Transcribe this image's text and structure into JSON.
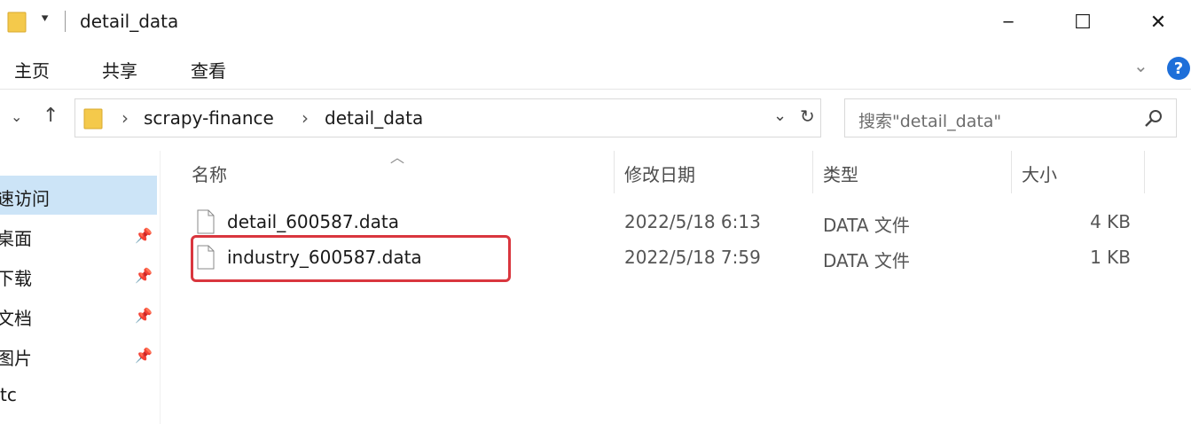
{
  "window": {
    "title": "detail_data",
    "minimize": "─",
    "maximize": "☐",
    "close": "✕"
  },
  "ribbon": {
    "tabs": [
      "主页",
      "共享",
      "查看"
    ],
    "expand": "⌄",
    "help": "?"
  },
  "address": {
    "crumbs": [
      "scrapy-finance",
      "detail_data"
    ],
    "separator": "›",
    "search_placeholder": "搜索\"detail_data\""
  },
  "nav_pane": {
    "items": [
      {
        "label": "速访问",
        "pinned": false
      },
      {
        "label": "桌面",
        "pinned": true
      },
      {
        "label": "下载",
        "pinned": true
      },
      {
        "label": "文档",
        "pinned": true
      },
      {
        "label": "图片",
        "pinned": true
      },
      {
        "label": "tc",
        "pinned": false
      }
    ]
  },
  "columns": {
    "name": "名称",
    "modified": "修改日期",
    "type": "类型",
    "size": "大小"
  },
  "files": [
    {
      "name": "detail_600587.data",
      "modified": "2022/5/18 6:13",
      "type": "DATA 文件",
      "size": "4 KB"
    },
    {
      "name": "industry_600587.data",
      "modified": "2022/5/18 7:59",
      "type": "DATA 文件",
      "size": "1 KB"
    }
  ],
  "colors": {
    "selection": "#cce4f7",
    "folder": "#f4c94b",
    "highlight": "#d9363e",
    "help": "#1e6fd9"
  }
}
